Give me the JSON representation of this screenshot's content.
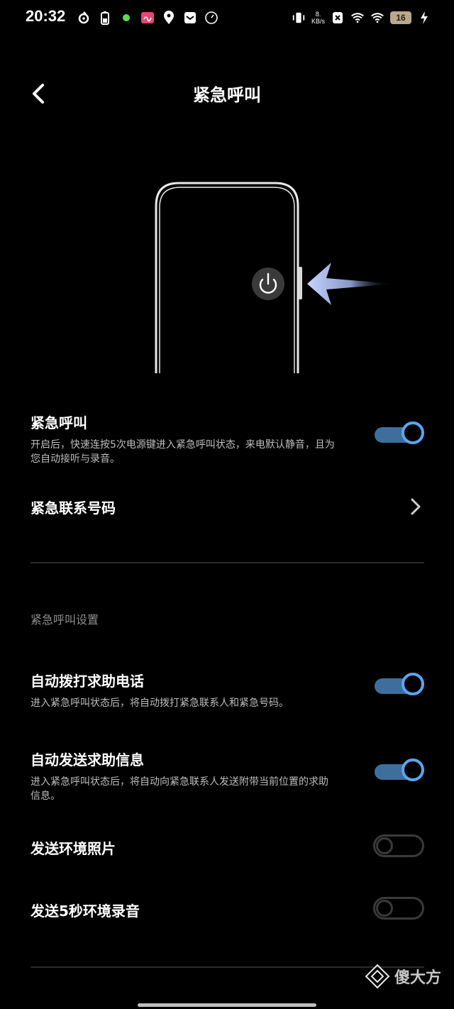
{
  "status_bar": {
    "time": "20:32",
    "net_speed_top": "8.",
    "net_speed_unit": "KB/s",
    "battery": "16"
  },
  "header": {
    "title": "紧急呼叫"
  },
  "settings": {
    "emergency_call": {
      "title": "紧急呼叫",
      "description": "开启后，快速连按5次电源键进入紧急呼叫状态，来电默认静音，且为您自动接听与录音。",
      "enabled": true
    },
    "emergency_contacts": {
      "title": "紧急联系号码"
    },
    "section_label": "紧急呼叫设置",
    "auto_dial": {
      "title": "自动拨打求助电话",
      "description": "进入紧急呼叫状态后，将自动拨打紧急联系人和紧急号码。",
      "enabled": true
    },
    "auto_message": {
      "title": "自动发送求助信息",
      "description": "进入紧急呼叫状态后，将自动向紧急联系人发送附带当前位置的求助信息。",
      "enabled": true
    },
    "send_photos": {
      "title": "发送环境照片",
      "enabled": false
    },
    "send_audio": {
      "title": "发送5秒环境录音",
      "enabled": false
    }
  },
  "watermark": {
    "text": "傻大方"
  },
  "colors": {
    "toggle_on_track": "#3e6e9c",
    "toggle_on_knob_ring": "#5aa6f2",
    "toggle_off": "#3a3a3a",
    "background": "#000000"
  }
}
